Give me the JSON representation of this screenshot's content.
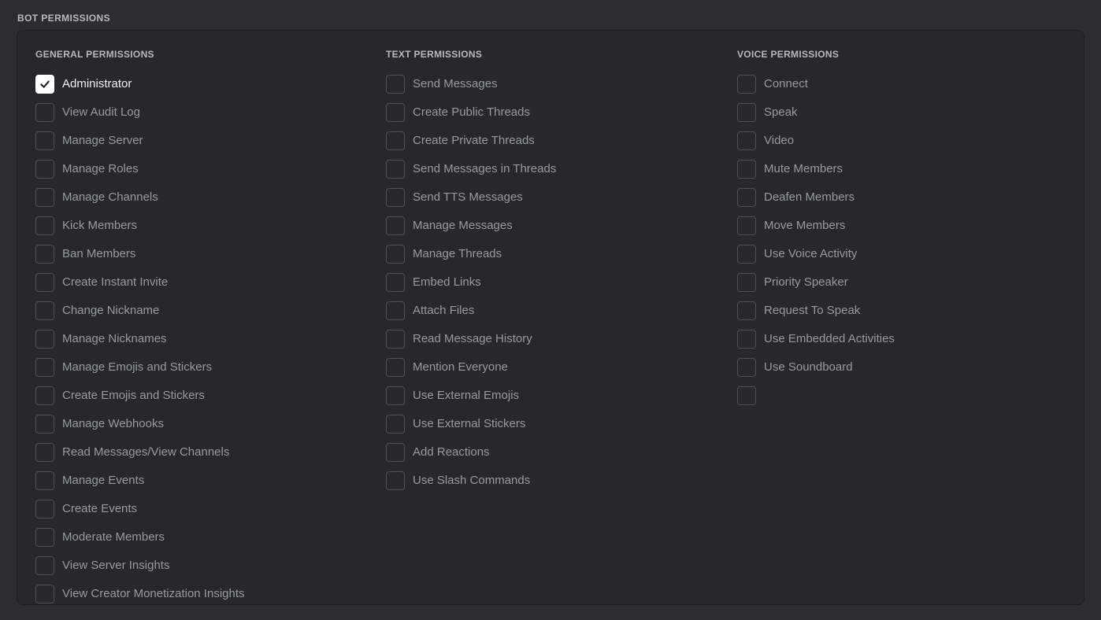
{
  "section": {
    "heading": "BOT PERMISSIONS"
  },
  "colors": {
    "page_background": "#2b2d31",
    "panel_background": "#26282c",
    "panel_border": "#1e1f22",
    "heading_text": "#b5bac1",
    "label_text": "#949ba4",
    "label_text_checked": "#f2f3f5",
    "checkbox_border": "#4e5058",
    "checkbox_checked_fill": "#ffffff",
    "checkmark": "#1e1f22"
  },
  "columns": [
    {
      "id": "general",
      "title": "GENERAL PERMISSIONS",
      "items": [
        {
          "label": "Administrator",
          "checked": true
        },
        {
          "label": "View Audit Log",
          "checked": false
        },
        {
          "label": "Manage Server",
          "checked": false
        },
        {
          "label": "Manage Roles",
          "checked": false
        },
        {
          "label": "Manage Channels",
          "checked": false
        },
        {
          "label": "Kick Members",
          "checked": false
        },
        {
          "label": "Ban Members",
          "checked": false
        },
        {
          "label": "Create Instant Invite",
          "checked": false
        },
        {
          "label": "Change Nickname",
          "checked": false
        },
        {
          "label": "Manage Nicknames",
          "checked": false
        },
        {
          "label": "Manage Emojis and Stickers",
          "checked": false
        },
        {
          "label": "Create Emojis and Stickers",
          "checked": false
        },
        {
          "label": "Manage Webhooks",
          "checked": false
        },
        {
          "label": "Read Messages/View Channels",
          "checked": false
        },
        {
          "label": "Manage Events",
          "checked": false
        },
        {
          "label": "Create Events",
          "checked": false
        },
        {
          "label": "Moderate Members",
          "checked": false
        },
        {
          "label": "View Server Insights",
          "checked": false
        },
        {
          "label": "View Creator Monetization Insights",
          "checked": false
        }
      ]
    },
    {
      "id": "text",
      "title": "TEXT PERMISSIONS",
      "items": [
        {
          "label": "Send Messages",
          "checked": false
        },
        {
          "label": "Create Public Threads",
          "checked": false
        },
        {
          "label": "Create Private Threads",
          "checked": false
        },
        {
          "label": "Send Messages in Threads",
          "checked": false
        },
        {
          "label": "Send TTS Messages",
          "checked": false
        },
        {
          "label": "Manage Messages",
          "checked": false
        },
        {
          "label": "Manage Threads",
          "checked": false
        },
        {
          "label": "Embed Links",
          "checked": false
        },
        {
          "label": "Attach Files",
          "checked": false
        },
        {
          "label": "Read Message History",
          "checked": false
        },
        {
          "label": "Mention Everyone",
          "checked": false
        },
        {
          "label": "Use External Emojis",
          "checked": false
        },
        {
          "label": "Use External Stickers",
          "checked": false
        },
        {
          "label": "Add Reactions",
          "checked": false
        },
        {
          "label": "Use Slash Commands",
          "checked": false
        }
      ]
    },
    {
      "id": "voice",
      "title": "VOICE PERMISSIONS",
      "items": [
        {
          "label": "Connect",
          "checked": false
        },
        {
          "label": "Speak",
          "checked": false
        },
        {
          "label": "Video",
          "checked": false
        },
        {
          "label": "Mute Members",
          "checked": false
        },
        {
          "label": "Deafen Members",
          "checked": false
        },
        {
          "label": "Move Members",
          "checked": false
        },
        {
          "label": "Use Voice Activity",
          "checked": false
        },
        {
          "label": "Priority Speaker",
          "checked": false
        },
        {
          "label": "Request To Speak",
          "checked": false
        },
        {
          "label": "Use Embedded Activities",
          "checked": false
        },
        {
          "label": "Use Soundboard",
          "checked": false
        },
        {
          "label": "",
          "checked": false
        }
      ]
    }
  ]
}
